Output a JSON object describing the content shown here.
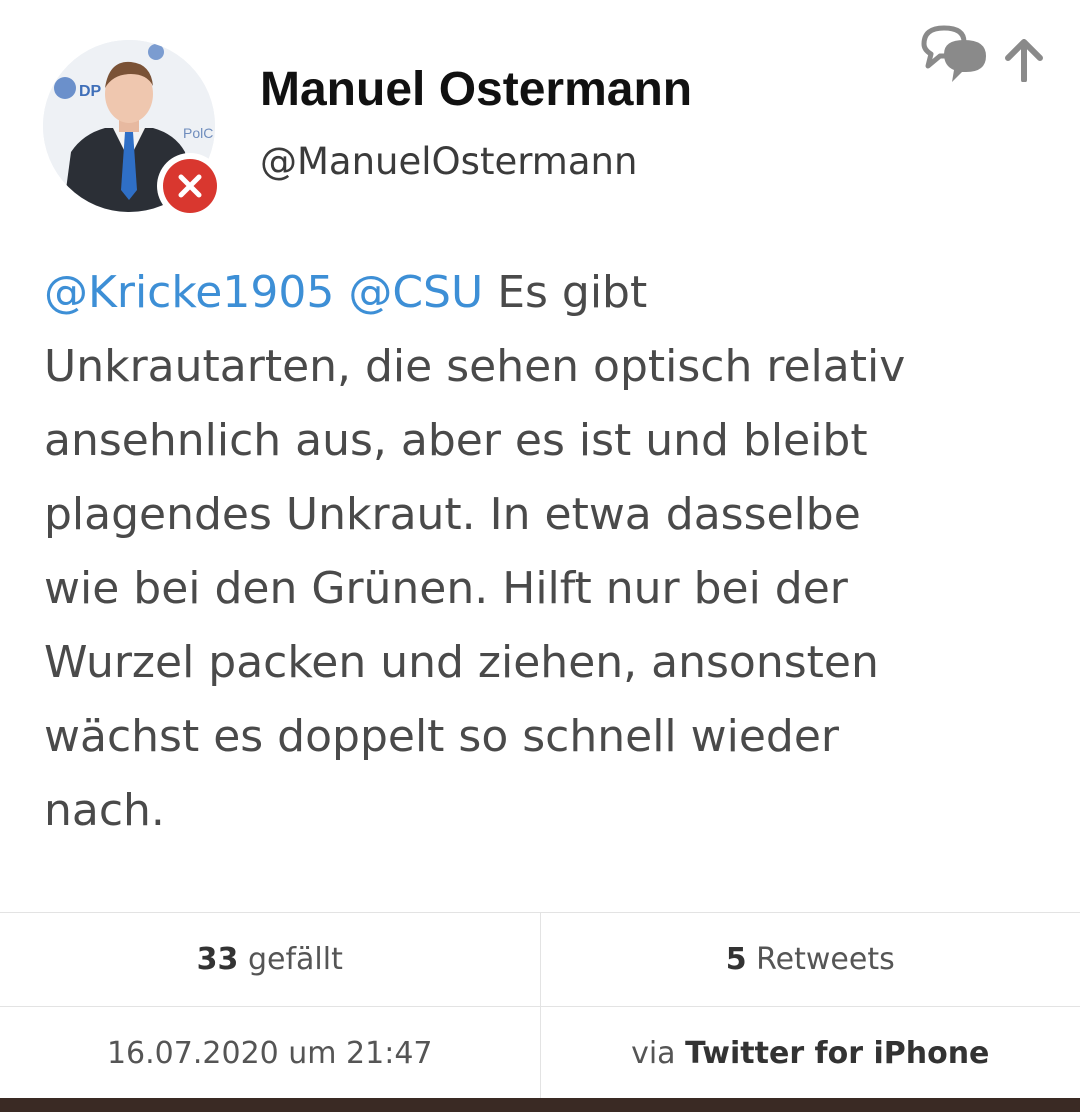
{
  "profile": {
    "display_name": "Manuel Ostermann",
    "handle": "@ManuelOstermann",
    "avatar_icon": "profile-photo",
    "badge_icon": "close-icon",
    "badge_color": "#d9372f",
    "avatar_sign_left": "DP",
    "avatar_sign_right": "PolC"
  },
  "actions": {
    "conversation_icon": "conversation-icon",
    "share_icon": "arrow-up-icon"
  },
  "tweet": {
    "mention_1": "@Kricke1905",
    "mention_2": "@CSU",
    "text_line_1": "Es gibt",
    "text_line_2": "Unkrautarten, die sehen optisch relativ",
    "text_line_3": "ansehnlich aus, aber es ist und bleibt",
    "text_line_4": "plagendes Unkraut. In etwa dasselbe",
    "text_line_5": "wie bei den Grünen. Hilft nur bei der",
    "text_line_6": "Wurzel packen und ziehen, ansonsten",
    "text_line_7": "wächst es doppelt so schnell wieder",
    "text_line_8": "nach.",
    "mention_color": "#3d8fd6"
  },
  "stats": {
    "likes_count": "33",
    "likes_label": "gefällt",
    "retweets_count": "5",
    "retweets_label": "Retweets",
    "timestamp": "16.07.2020 um 21:47",
    "source_prefix": "via",
    "source_app": "Twitter for iPhone"
  }
}
